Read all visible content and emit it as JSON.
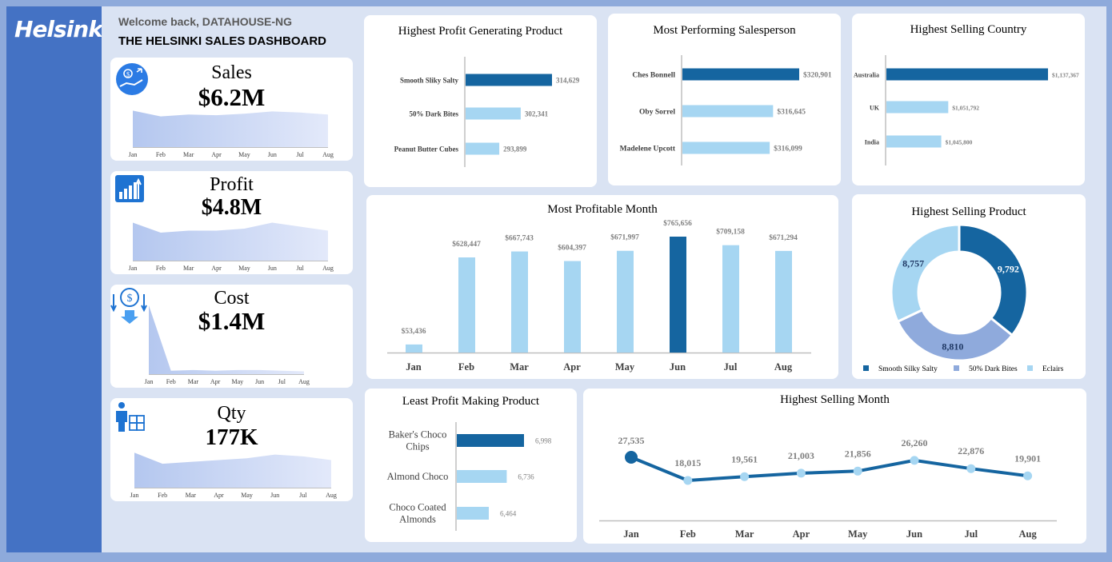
{
  "header": {
    "brand": "Helsinki",
    "welcome": "Welcome back, DATAHOUSE-NG",
    "title": "THE HELSINKI SALES DASHBOARD"
  },
  "kpis": {
    "sales": {
      "label": "Sales",
      "value": "$6.2M",
      "icon": "money-hand-icon"
    },
    "profit": {
      "label": "Profit",
      "value": "$4.8M",
      "icon": "bar-chart-up-icon"
    },
    "cost": {
      "label": "Cost",
      "value": "$1.4M",
      "icon": "dollar-down-icon"
    },
    "qty": {
      "label": "Qty",
      "value": "177K",
      "icon": "person-boxes-icon"
    },
    "months": [
      "Jan",
      "Feb",
      "Mar",
      "Apr",
      "May",
      "Jun",
      "Jul",
      "Aug"
    ]
  },
  "colors": {
    "dark": "#1565a0",
    "light": "#a6d6f2",
    "mid": "#8faadc",
    "lightest": "#d9e4f7",
    "area": "#b4c7ef"
  },
  "chart_data": [
    {
      "id": "highest_profit_product",
      "type": "bar",
      "orientation": "horizontal",
      "title": "Highest Profit Generating Product",
      "categories": [
        "Smooth Sliky Salty",
        "50% Dark Bites",
        "Peanut Butter Cubes"
      ],
      "values": [
        314629,
        302341,
        293899
      ],
      "labels": [
        "314,629",
        "302,341",
        "293,899"
      ],
      "highlight": 0
    },
    {
      "id": "top_salesperson",
      "type": "bar",
      "orientation": "horizontal",
      "title": "Most Performing Salesperson",
      "categories": [
        "Ches Bonnell",
        "Oby Sorrel",
        "Madelene Upcott"
      ],
      "values": [
        320901,
        316645,
        316099
      ],
      "labels": [
        "$320,901",
        "$316,645",
        "$316,099"
      ],
      "highlight": 0
    },
    {
      "id": "top_country",
      "type": "bar",
      "orientation": "horizontal",
      "title": "Highest Selling Country",
      "categories": [
        "Australia",
        "UK",
        "India"
      ],
      "values": [
        1137367,
        1051792,
        1045800
      ],
      "labels": [
        "$1,137,367",
        "$1,051,792",
        "$1,045,800"
      ],
      "highlight": 0
    },
    {
      "id": "profitable_month",
      "type": "bar",
      "title": "Most Profitable Month",
      "categories": [
        "Jan",
        "Feb",
        "Mar",
        "Apr",
        "May",
        "Jun",
        "Jul",
        "Aug"
      ],
      "values": [
        53436,
        628447,
        667743,
        604397,
        671997,
        765656,
        709158,
        671294
      ],
      "labels": [
        "$53,436",
        "$628,447",
        "$667,743",
        "$604,397",
        "$671,997",
        "$765,656",
        "$709,158",
        "$671,294"
      ],
      "highlight": 5
    },
    {
      "id": "top_product_share",
      "type": "pie",
      "variant": "donut",
      "title": "Highest Selling Product",
      "categories": [
        "Smooth Silky Salty",
        "50% Dark Bites",
        "Eclairs"
      ],
      "values": [
        9792,
        8810,
        8757
      ],
      "labels": [
        "9,792",
        "8,810",
        "8,757"
      ],
      "legend": "bottom"
    },
    {
      "id": "least_profit_product",
      "type": "bar",
      "orientation": "horizontal",
      "title": "Least Profit Making Product",
      "categories": [
        "Baker's Choco Chips",
        "Almond Choco",
        "Choco Coated Almonds"
      ],
      "category_lines": [
        [
          "Baker's Choco",
          "Chips"
        ],
        [
          "Almond Choco"
        ],
        [
          "Choco Coated",
          "Almonds"
        ]
      ],
      "values": [
        6998,
        6736,
        6464
      ],
      "labels": [
        "6,998",
        "6,736",
        "6,464"
      ],
      "highlight": 0
    },
    {
      "id": "selling_month",
      "type": "line",
      "title": "Highest Selling Month",
      "categories": [
        "Jan",
        "Feb",
        "Mar",
        "Apr",
        "May",
        "Jun",
        "Jul",
        "Aug"
      ],
      "values": [
        27535,
        18015,
        19561,
        21003,
        21856,
        26260,
        22876,
        19901
      ],
      "labels": [
        "27,535",
        "18,015",
        "19,561",
        "21,003",
        "21,856",
        "26,260",
        "22,876",
        "19,901"
      ],
      "highlight": 0
    },
    {
      "id": "sales_trend",
      "type": "area",
      "categories": [
        "Jan",
        "Feb",
        "Mar",
        "Apr",
        "May",
        "Jun",
        "Jul",
        "Aug"
      ],
      "values": [
        0.95,
        0.8,
        0.85,
        0.83,
        0.87,
        0.93,
        0.9,
        0.85
      ]
    },
    {
      "id": "profit_trend",
      "type": "area",
      "categories": [
        "Jan",
        "Feb",
        "Mar",
        "Apr",
        "May",
        "Jun",
        "Jul",
        "Aug"
      ],
      "values": [
        0.95,
        0.7,
        0.75,
        0.75,
        0.8,
        0.95,
        0.85,
        0.75
      ]
    },
    {
      "id": "cost_trend",
      "type": "area",
      "categories": [
        "Jan",
        "Feb",
        "Mar",
        "Apr",
        "May",
        "Jun",
        "Jul",
        "Aug"
      ],
      "values": [
        1.0,
        0.05,
        0.06,
        0.05,
        0.06,
        0.06,
        0.05,
        0.04
      ]
    },
    {
      "id": "qty_trend",
      "type": "area",
      "categories": [
        "Jan",
        "Feb",
        "Mar",
        "Apr",
        "May",
        "Jun",
        "Jul",
        "Aug"
      ],
      "values": [
        0.95,
        0.65,
        0.7,
        0.75,
        0.8,
        0.9,
        0.85,
        0.75
      ]
    }
  ]
}
